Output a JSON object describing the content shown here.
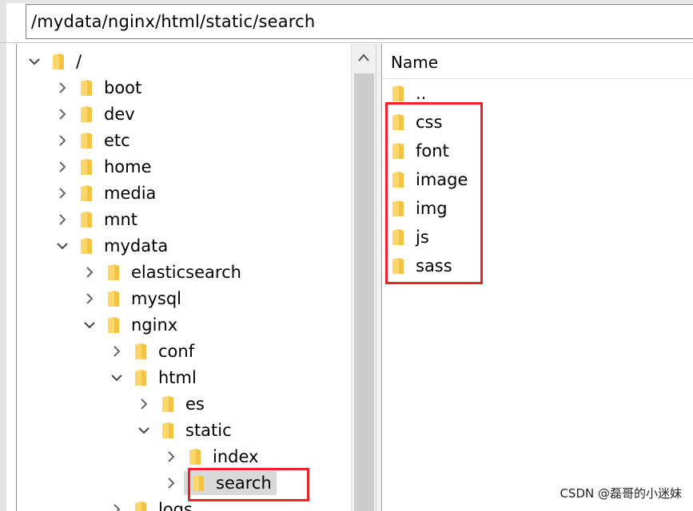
{
  "address_bar": {
    "path": "/mydata/nginx/html/static/search"
  },
  "tree": {
    "root": {
      "label": "/"
    },
    "items": [
      {
        "label": "boot"
      },
      {
        "label": "dev"
      },
      {
        "label": "etc"
      },
      {
        "label": "home"
      },
      {
        "label": "media"
      },
      {
        "label": "mnt"
      },
      {
        "label": "mydata"
      },
      {
        "label": "elasticsearch"
      },
      {
        "label": "mysql"
      },
      {
        "label": "nginx"
      },
      {
        "label": "conf"
      },
      {
        "label": "html"
      },
      {
        "label": "es"
      },
      {
        "label": "static"
      },
      {
        "label": "index"
      },
      {
        "label": "search"
      },
      {
        "label": "logs"
      }
    ]
  },
  "file_list": {
    "header": "Name",
    "items": [
      {
        "label": ".."
      },
      {
        "label": "css"
      },
      {
        "label": "font"
      },
      {
        "label": "image"
      },
      {
        "label": "img"
      },
      {
        "label": "js"
      },
      {
        "label": "sass"
      }
    ]
  },
  "watermark": "CSDN @磊哥的小迷妹",
  "colors": {
    "highlight": "#e8232a",
    "folder": "#f5c342",
    "selection": "#d9d9d9"
  },
  "icons": {
    "folder": "folder-icon",
    "expand": "chevron-right-icon",
    "collapse": "chevron-down-icon",
    "scroll_up": "scroll-up-arrow-icon"
  }
}
